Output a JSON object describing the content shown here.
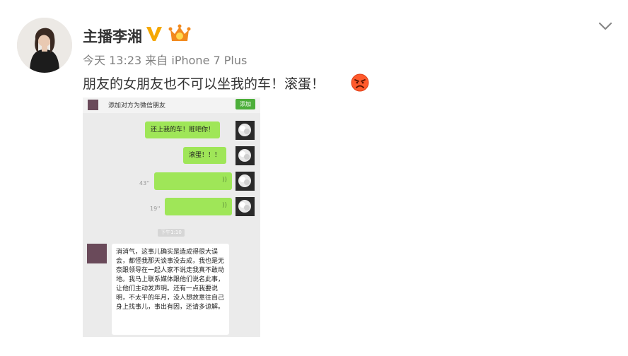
{
  "post": {
    "username": "主播李湘",
    "time": "今天 13:23",
    "source_prefix": "来自",
    "source_device": "iPhone 7 Plus",
    "text": "朋友的女朋友也不可以坐我的车！滚蛋！"
  },
  "icons": {
    "verified": "verified-v-badge",
    "vip": "vip-crown-badge",
    "menu": "chevron-down-icon",
    "emoji": "angry-face-emoji"
  },
  "colors": {
    "verified_gold": "#f5a800",
    "bubble_green": "#9fe658",
    "add_button_green": "#4cae3a",
    "chat_bg": "#ebebeb"
  },
  "chat": {
    "banner_text": "添加对方为微信朋友",
    "add_label": "添加",
    "messages": [
      {
        "type": "text",
        "text": "还上我的车！赃吧你！"
      },
      {
        "type": "text",
        "text": "滚蛋！！！"
      },
      {
        "type": "voice",
        "duration": "43''"
      },
      {
        "type": "voice",
        "duration": "19''"
      }
    ],
    "time_label": "下午1:10",
    "reply": "消消气，这事儿确实是造成得很大误会，都怪我那天谈事没去成，我也是无奈跟领导在一起人家不说走我真不敢动地。我马上联系媒体跟他们说名此事，让他们主动发声明。还有一点我要说明，不太平的年月，没人想故意往自己身上找事儿，事出有因，还请多谅解。"
  }
}
